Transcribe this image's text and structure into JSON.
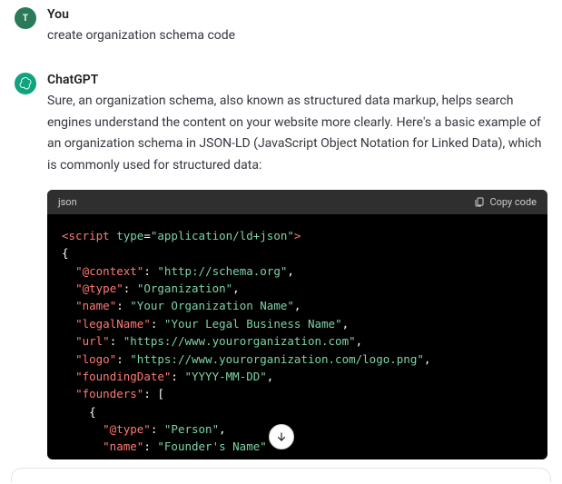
{
  "user": {
    "avatar_letter": "T",
    "name": "You",
    "message": "create organization schema code"
  },
  "assistant": {
    "name": "ChatGPT",
    "intro": "Sure, an organization schema, also known as structured data markup, helps search engines understand the content on your website more clearly. Here's a basic example of an organization schema in JSON-LD (JavaScript Object Notation for Linked Data), which is commonly used for structured data:"
  },
  "code": {
    "language_label": "json",
    "copy_label": "Copy code",
    "script_open_tag": "<script",
    "type_attr_name": "type",
    "type_attr_eq": "=",
    "type_attr_value": "\"application/ld+json\"",
    "script_open_close": ">",
    "brace_open": "{",
    "brace_close": "}",
    "bracket_open": "[",
    "comma": ",",
    "colon": ":",
    "indent1": "  ",
    "indent2": "    ",
    "indent3": "      ",
    "keys": {
      "context": "\"@context\"",
      "type": "\"@type\"",
      "name": "\"name\"",
      "legalName": "\"legalName\"",
      "url": "\"url\"",
      "logo": "\"logo\"",
      "foundingDate": "\"foundingDate\"",
      "founders": "\"founders\"",
      "person_type": "\"@type\"",
      "founder_name": "\"name\""
    },
    "values": {
      "context": "\"http://schema.org\"",
      "type": "\"Organization\"",
      "name": "\"Your Organization Name\"",
      "legalName": "\"Your Legal Business Name\"",
      "url": "\"https://www.yourorganization.com\"",
      "logo": "\"https://www.yourorganization.com/logo.png\"",
      "foundingDate": "\"YYYY-MM-DD\"",
      "person_type": "\"Person\"",
      "founder_name": "\"Founder's Name\""
    }
  }
}
